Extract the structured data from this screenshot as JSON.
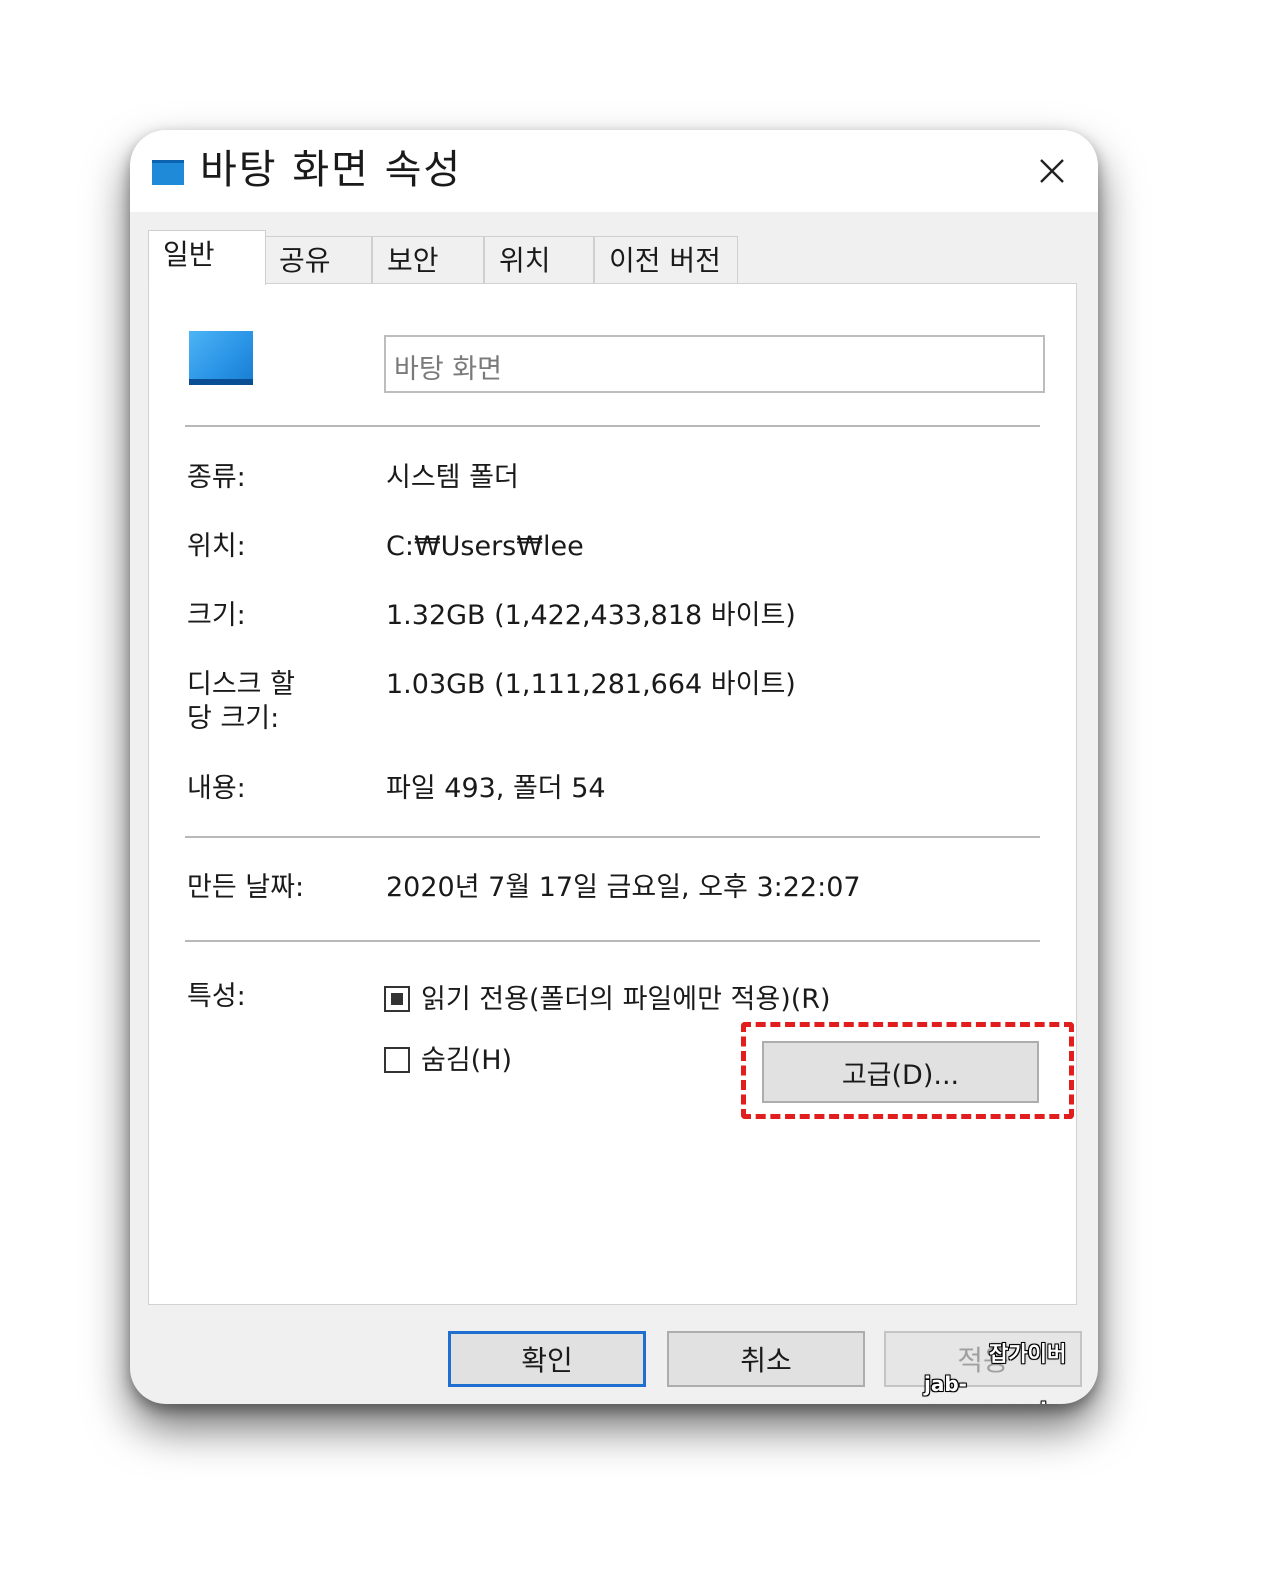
{
  "window": {
    "title": "바탕 화면 속성",
    "title_icon": "folder-icon",
    "close_icon": "close-icon"
  },
  "tabs": [
    {
      "label": "일반",
      "active": true
    },
    {
      "label": "공유"
    },
    {
      "label": "보안"
    },
    {
      "label": "위치"
    },
    {
      "label": "이전 버전"
    }
  ],
  "general": {
    "folder_icon": "desktop-folder-icon",
    "name_value": "바탕 화면",
    "rows": [
      {
        "label": "종류:",
        "value": "시스템 폴더"
      },
      {
        "label": "위치:",
        "value": "C:₩Users₩lee"
      },
      {
        "label": "크기:",
        "value": "1.32GB (1,422,433,818 바이트)"
      },
      {
        "label_line1": "디스크 할",
        "label_line2": "당 크기:",
        "value": "1.03GB (1,111,281,664 바이트)"
      },
      {
        "label": "내용:",
        "value": "파일 493, 폴더 54"
      },
      {
        "label": "만든 날짜:",
        "value": "2020년 7월 17일 금요일, 오후 3:22:07"
      }
    ],
    "attributes": {
      "label": "특성:",
      "readonly": {
        "label": "읽기 전용(폴더의 파일에만 적용)(R)",
        "state": "indeterminate"
      },
      "hidden": {
        "label": "숨김(H)",
        "checked": false
      },
      "advanced_button": "고급(D)..."
    }
  },
  "buttons": {
    "ok": "확인",
    "cancel": "취소",
    "apply": "적용"
  },
  "highlight_color": "#e11d1d",
  "watermark": {
    "line1": "잡가이버",
    "line2": "jab-guyver.co.kr"
  }
}
